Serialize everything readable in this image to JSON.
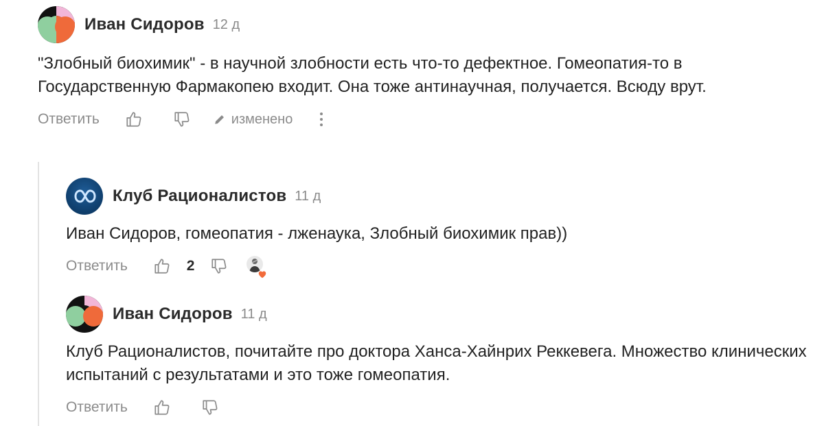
{
  "comments": [
    {
      "author": "Иван Сидоров",
      "time": "12 д",
      "text": "\"Злобный биохимик\" - в научной злобности есть что-то дефектное. Гомеопатия-то в Государственную Фармакопею входит. Она тоже антинаучная, получается. Всюду врут.",
      "reply_label": "Ответить",
      "edited_label": "изменено"
    },
    {
      "author": "Клуб Рационалистов",
      "time": "11 д",
      "text": "Иван Сидоров, гомеопатия - лженаука, Злобный биохимик прав))",
      "reply_label": "Ответить",
      "likes": "2"
    },
    {
      "author": "Иван Сидоров",
      "time": "11 д",
      "text": "Клуб Рационалистов, почитайте про доктора Ханса-Хайнрих Реккевега. Множество клинических испытаний с результатами и это тоже гомеопатия.",
      "reply_label": "Ответить"
    }
  ],
  "colors": {
    "avatar_green": "#8fcf9f",
    "avatar_orange": "#ef6a3a",
    "avatar_pink": "#f2b6d8",
    "avatar_black": "#111111",
    "club_avatar_bg": "#0d3a66",
    "heart": "#f26b3a",
    "muted_text": "#8b8b8b"
  },
  "icons": [
    "thumbs-up-icon",
    "thumbs-down-icon",
    "pencil-icon",
    "more-vertical-icon",
    "infinity-logo",
    "heart-icon"
  ]
}
